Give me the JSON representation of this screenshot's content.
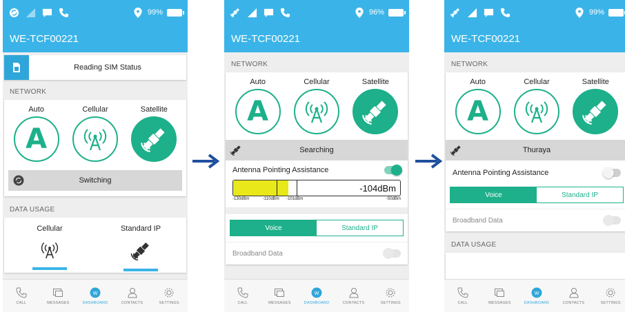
{
  "colors": {
    "header": "#3ab4e8",
    "accent": "#1db08a",
    "signal_fill": "#e8e81a",
    "arrow": "#1f4f9e"
  },
  "screen1": {
    "status": {
      "battery": "99%"
    },
    "title": "WE-TCF00221",
    "sim_status": "Reading SIM Status",
    "network_label": "NETWORK",
    "options": {
      "auto": "Auto",
      "cellular": "Cellular",
      "satellite": "Satellite"
    },
    "selected": "satellite",
    "state_text": "Switching",
    "data_usage_label": "DATA USAGE",
    "usage": {
      "cellular": "Cellular",
      "standard_ip": "Standard IP"
    }
  },
  "screen2": {
    "status": {
      "battery": "96%"
    },
    "title": "WE-TCF00221",
    "network_label": "NETWORK",
    "options": {
      "auto": "Auto",
      "cellular": "Cellular",
      "satellite": "Satellite"
    },
    "selected": "satellite",
    "state_text": "Searching",
    "antenna_label": "Antenna Pointing Assistance",
    "antenna_on": true,
    "signal": {
      "value": "-104dBm",
      "fill_fraction": 0.33,
      "ticks": [
        "-130dBm",
        "-110dBm",
        "-101dBm",
        "-50dBm"
      ]
    },
    "segments": {
      "voice": "Voice",
      "standard_ip": "Standard IP"
    },
    "broadband_label": "Broadband Data"
  },
  "screen3": {
    "status": {
      "battery": "99%"
    },
    "title": "WE-TCF00221",
    "network_label": "NETWORK",
    "options": {
      "auto": "Auto",
      "cellular": "Cellular",
      "satellite": "Satellite"
    },
    "selected": "satellite",
    "state_text": "Thuraya",
    "antenna_label": "Antenna Pointing Assistance",
    "antenna_on": false,
    "segments": {
      "voice": "Voice",
      "standard_ip": "Standard IP"
    },
    "broadband_label": "Broadband Data",
    "data_usage_label": "DATA USAGE"
  },
  "tabs": [
    {
      "label": "CALL",
      "icon": "phone-icon"
    },
    {
      "label": "MESSAGES",
      "icon": "messages-icon"
    },
    {
      "label": "DASHBOARD",
      "icon": "dashboard-icon",
      "active": true
    },
    {
      "label": "CONTACTS",
      "icon": "contacts-icon"
    },
    {
      "label": "SETTINGS",
      "icon": "settings-icon"
    }
  ]
}
